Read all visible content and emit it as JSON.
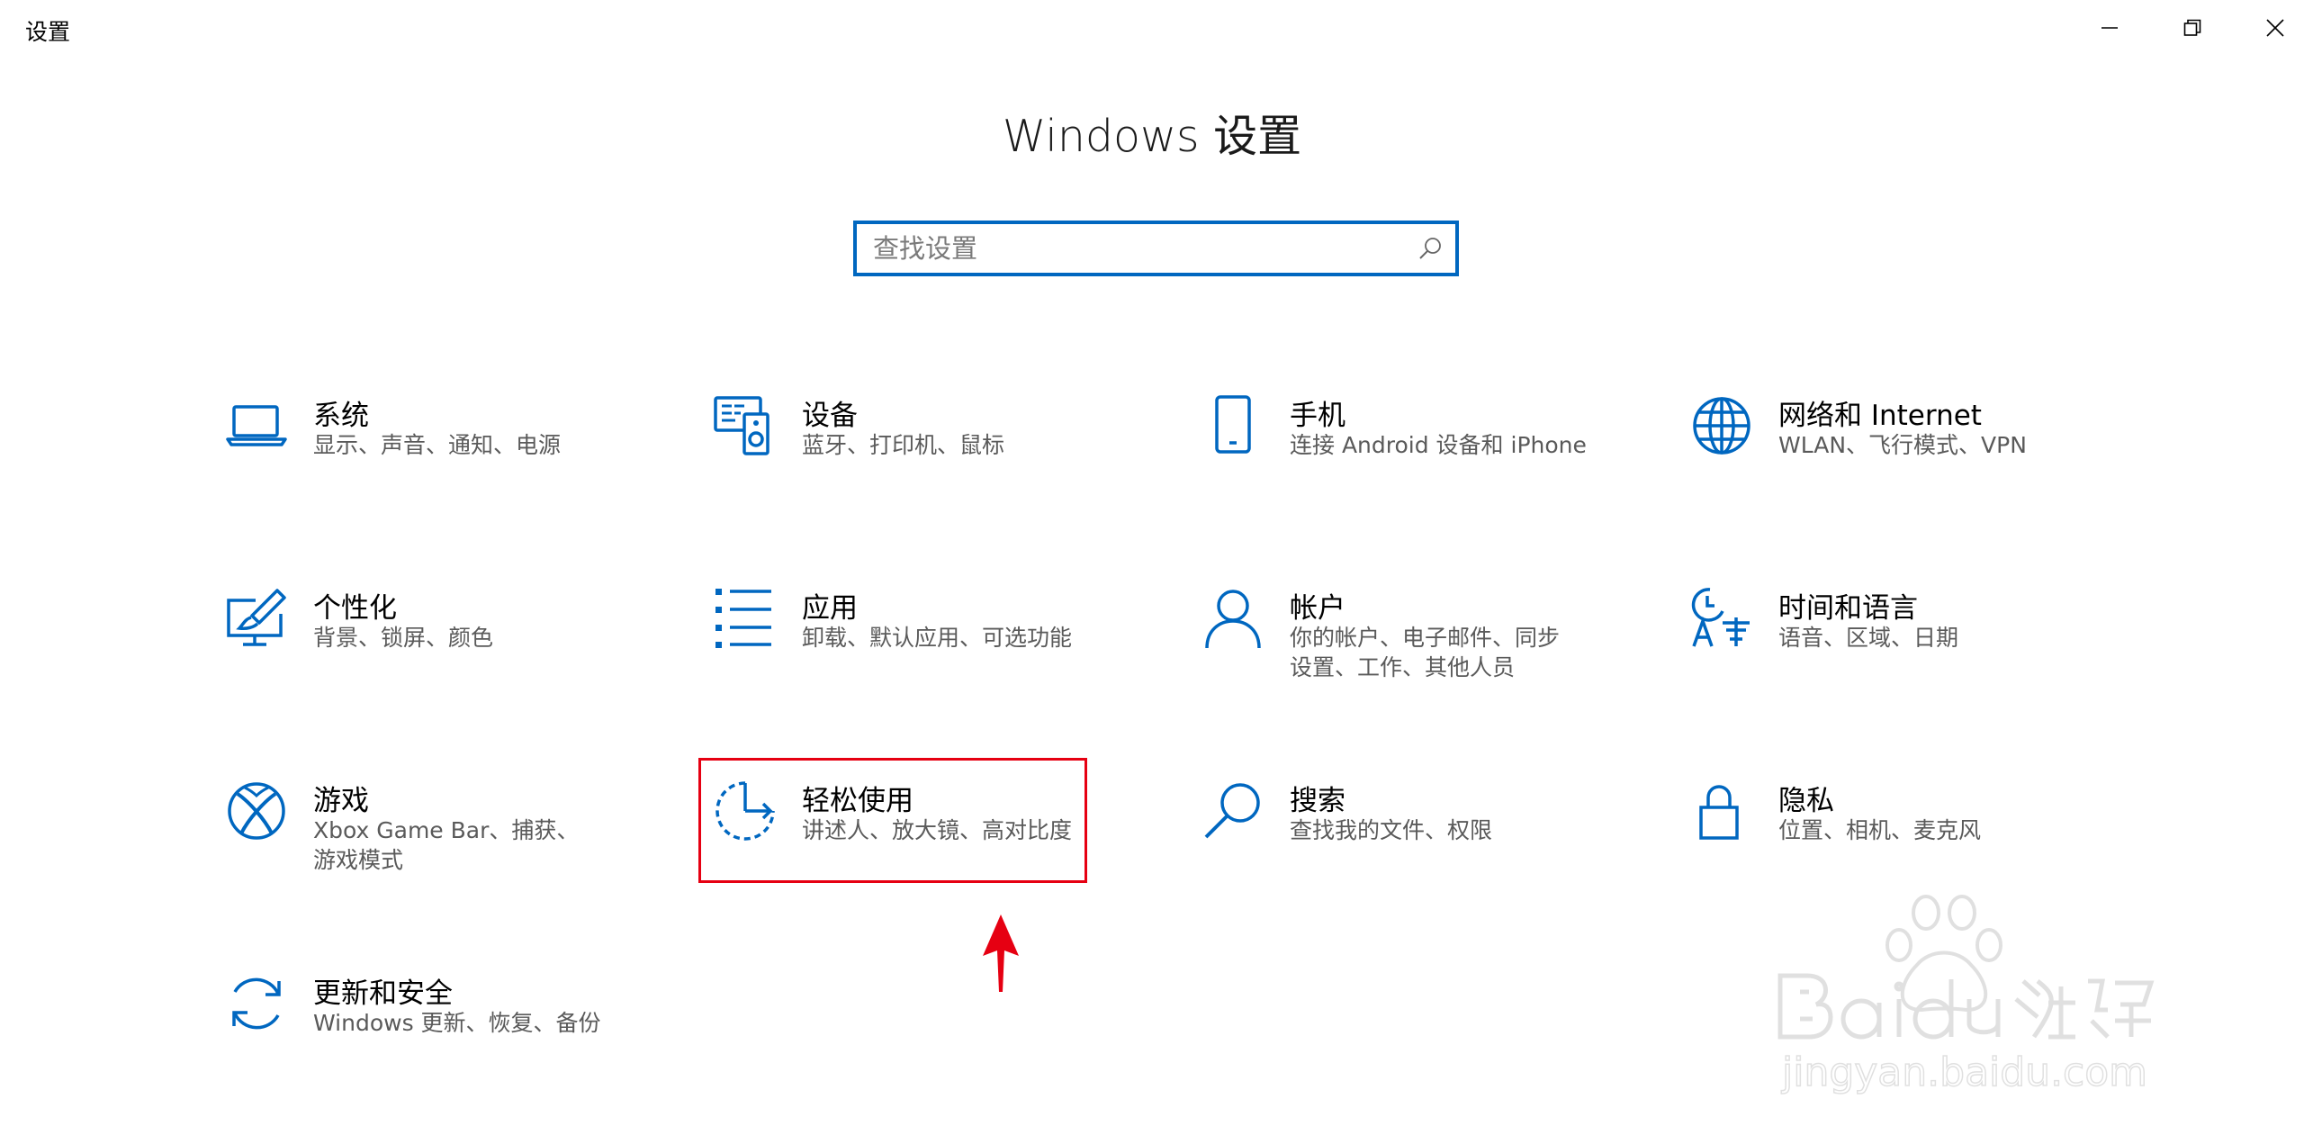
{
  "window": {
    "title": "设置"
  },
  "header": {
    "title": "Windows 设置"
  },
  "search": {
    "placeholder": "查找设置"
  },
  "tiles": [
    {
      "title": "系统",
      "desc": "显示、声音、通知、电源"
    },
    {
      "title": "设备",
      "desc": "蓝牙、打印机、鼠标"
    },
    {
      "title": "手机",
      "desc": "连接 Android 设备和 iPhone"
    },
    {
      "title": "网络和 Internet",
      "desc": "WLAN、飞行模式、VPN"
    },
    {
      "title": "个性化",
      "desc": "背景、锁屏、颜色"
    },
    {
      "title": "应用",
      "desc": "卸载、默认应用、可选功能"
    },
    {
      "title": "帐户",
      "desc": "你的帐户、电子邮件、同步设置、工作、其他人员"
    },
    {
      "title": "时间和语言",
      "desc": "语音、区域、日期"
    },
    {
      "title": "游戏",
      "desc": "Xbox Game Bar、捕获、游戏模式"
    },
    {
      "title": "轻松使用",
      "desc": "讲述人、放大镜、高对比度"
    },
    {
      "title": "搜索",
      "desc": "查找我的文件、权限"
    },
    {
      "title": "隐私",
      "desc": "位置、相机、麦克风"
    },
    {
      "title": "更新和安全",
      "desc": "Windows 更新、恢复、备份"
    }
  ],
  "watermark": {
    "brand": "Baidu经验",
    "url": "jingyan.baidu.com"
  },
  "colors": {
    "accent": "#0067c0",
    "highlight": "#e60012",
    "text_secondary": "#5a5a5a"
  },
  "icons": [
    "laptop-icon",
    "devices-icon",
    "phone-icon",
    "globe-icon",
    "personalization-icon",
    "apps-icon",
    "account-icon",
    "time-language-icon",
    "xbox-icon",
    "ease-of-access-icon",
    "search-icon",
    "lock-icon",
    "update-icon"
  ]
}
